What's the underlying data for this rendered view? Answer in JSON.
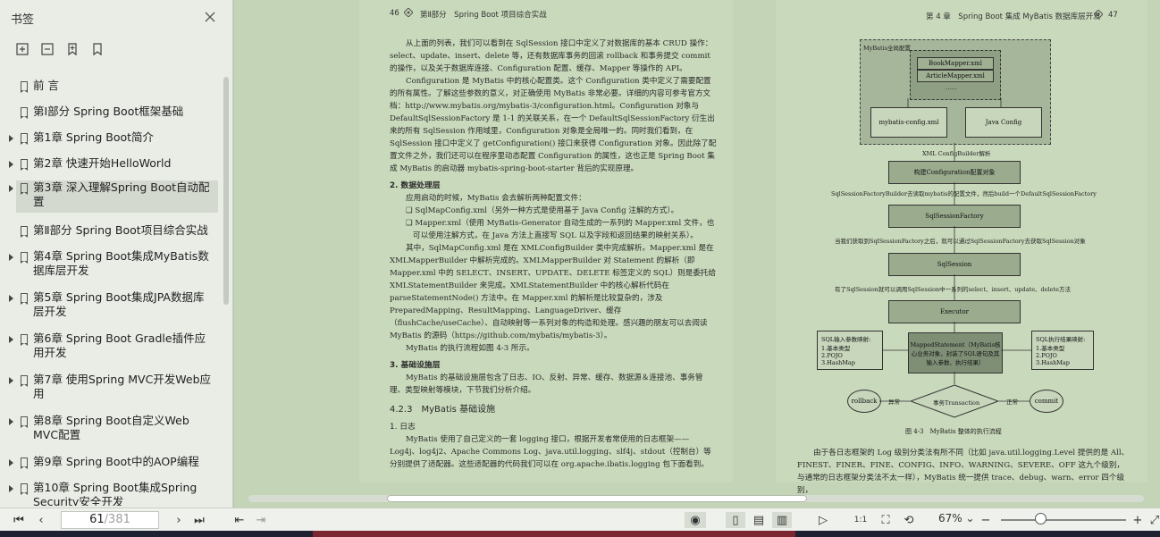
{
  "sidebar": {
    "title": "书签",
    "items": [
      {
        "label": "前 言",
        "expandable": false
      },
      {
        "label": "第Ⅰ部分 Spring Boot框架基础",
        "expandable": false
      },
      {
        "label": "第1章 Spring Boot简介",
        "expandable": true
      },
      {
        "label": "第2章 快速开始HelloWorld",
        "expandable": true
      },
      {
        "label": "第3章 深入理解Spring Boot自动配置",
        "expandable": true,
        "selected": true
      },
      {
        "label": "第Ⅱ部分 Spring Boot项目综合实战",
        "expandable": false
      },
      {
        "label": "第4章 Spring Boot集成MyBatis数据库层开发",
        "expandable": true
      },
      {
        "label": "第5章 Spring Boot集成JPA数据库层开发",
        "expandable": true
      },
      {
        "label": "第6章 Spring Boot Gradle插件应用开发",
        "expandable": true
      },
      {
        "label": "第7章 使用Spring MVC开发Web应用",
        "expandable": true
      },
      {
        "label": "第8章 Spring Boot自定义Web MVC配置",
        "expandable": true
      },
      {
        "label": "第9章 Spring Boot中的AOP编程",
        "expandable": true
      },
      {
        "label": "第10章 Spring Boot集成Spring Security安全开发",
        "expandable": true
      }
    ]
  },
  "left_page": {
    "page_number": "46",
    "header": "第Ⅱ部分　Spring Boot 项目综合实战",
    "paragraphs": [
      "从上面的列表，我们可以看到在 SqlSession 接口中定义了对数据库的基本 CRUD 操作：select、update、insert、delete 等，还有数据库事务的回滚 rollback 和事务提交 commit 的操作，以及关于数据库连接、Configuration 配置、缓存、Mapper 等操作的 API。",
      "Configuration 是 MyBatis 中的核心配置类。这个 Configuration 类中定义了需要配置的所有属性。了解这些参数的意义，对正确使用 MyBatis 非常必要。详细的内容可参考官方文档：http://www.mybatis.org/mybatis-3/configuration.html。Configuration 对象与 DefaultSqlSessionFactory 是 1-1 的关联关系，在一个 DefaultSqlSessionFactory 衍生出来的所有 SqlSession 作用域里，Configuration 对象是全局唯一的。同时我们看到，在 SqlSession 接口中定义了 getConfiguration() 接口来获得 Configuration 对象。因此除了配置文件之外，我们还可以在程序里动态配置 Configuration 的属性，这也正是 Spring Boot 集成 MyBatis 的启动器 mybatis-spring-boot-starter 背后的实现原理。"
    ],
    "section2_title": "2. 数据处理层",
    "section2_intro": "应用启动的时候，MyBatis 会去解析两种配置文件：",
    "bullets": [
      "❑ SqlMapConfig.xml（另外一种方式是使用基于 Java Config 注解的方式）。",
      "❑ Mapper.xml（使用 MyBatis-Generator 自动生成的一系列的 Mapper.xml 文件，也可以使用注解方式，在 Java 方法上直接写 SQL 以及字段和返回结果的映射关系）。"
    ],
    "section2_body": "其中，SqlMapConfig.xml 是在 XMLConfigBuilder 类中完成解析。Mapper.xml 是在 XMLMapperBuilder 中解析完成的。XMLMapperBuilder 对 Statement 的解析（即 Mapper.xml 中的 SELECT、INSERT、UPDATE、DELETE 标签定义的 SQL）则是委托给 XMLStatementBuilder 来完成。XMLStatementBuilder 中的核心解析代码在 parseStatementNode() 方法中。在 Mapper.xml 的解析是比较复杂的，涉及 PreparedMapping、ResultMapping、LanguageDriver、缓存（flushCache/useCache）、自动映射等一系列对象的构造和处理。感兴趣的朋友可以去阅读 MyBatis 的源码（https://github.com/mybatis/mybatis-3）。",
    "section2_tail": "MyBatis 的执行流程如图 4-3 所示。",
    "section3_title": "3. 基础设施层",
    "section3_body": "MyBatis 的基础设施层包含了日志、IO、反射、异常、缓存、数据源＆连接池、事务管理、类型映射等模块，下节我们分析介绍。",
    "subsection_title": "4.2.3　MyBatis 基础设施",
    "sub1_title": "1. 日志",
    "sub1_body": "MyBatis 使用了自己定义的一套 logging 接口，根据开发者常使用的日志框架—— Log4j、log4j2、Apache Commons Log、java.util.logging、slf4j、stdout（控制台）等分别提供了适配器。这些适配器的代码我们可以在 org.apache.ibatis.logging 包下面看到。"
  },
  "right_page": {
    "page_number": "47",
    "header": "第 4 章　Spring Boot 集成 MyBatis 数据库层开发",
    "diagram": {
      "global_config": "MyBatis全局配置",
      "mapper1": "BookMapper.xml",
      "mapper2": "ArticleMapper.xml",
      "ellipsis": "……",
      "config_xml": "mybatis-config.xml",
      "java_config": "Java Config",
      "parse_label": "XML ConfigBuilder解析",
      "build_config": "构建Configuration配置对象",
      "factory_builder_label": "SqlSessionFactoryBuilder去读取mybatis的配置文件，然后build一个DefaultSqlSessionFactory",
      "factory": "SqlSessionFactory",
      "get_session_label": "当我们获取到SqlSessionFactory之后，就可以通过SqlSessionFactory去获取SqlSession对象",
      "session": "SqlSession",
      "methods_label": "有了SqlSession就可以调用SqlSession中一系列的select、insert、update、delete方法",
      "executor": "Executor",
      "input_map": "SQL输入参数映射:\n1.基本类型\n2.POJO\n3.HashMap",
      "mapped_statement": "MappedStatement（MyBatis核心业务对象，封装了SQL语句及其输入参数、执行结果）",
      "output_map": "SQL执行结果映射:\n1.基本类型\n2.POJO\n3.HashMap",
      "rollback": "rollback",
      "exception": "异常",
      "transaction": "事务Transaction",
      "normal": "正常",
      "commit": "commit",
      "caption": "图 4-3　MyBatis 整体的执行流程"
    },
    "body": "由于各日志框架的 Log 级别分类法有所不同（比如 java.util.logging.Level 提供的是 All、FINEST、FINER、FINE、CONFIG、INFO、WARNING、SEVERE、OFF 这九个级别，与通常的日志框架分类法不太一样），MyBatis 统一提供 trace、debug、warn、error 四个级别，"
  },
  "bottombar": {
    "current_page": "61",
    "total_pages": "/381",
    "zoom": "67%"
  }
}
